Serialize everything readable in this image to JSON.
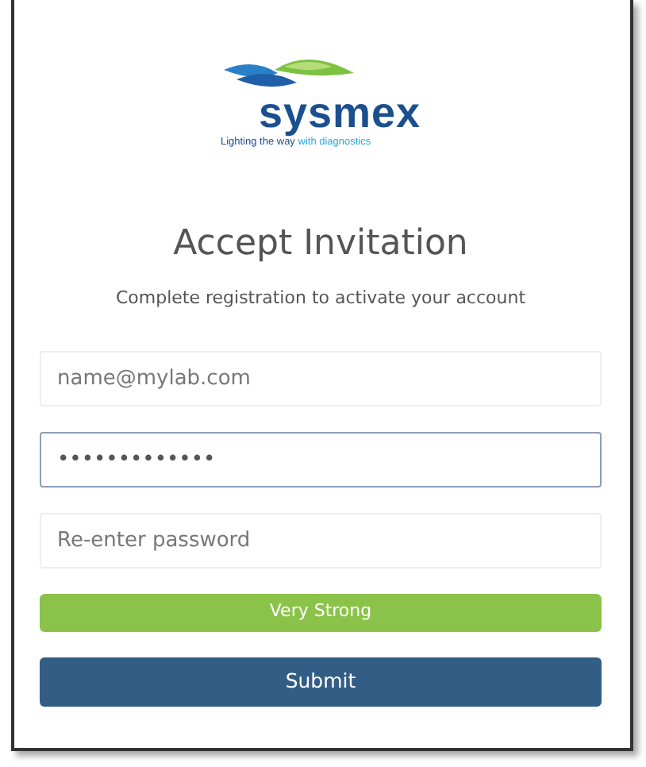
{
  "logo": {
    "wordmark": "sysmex",
    "tagline": "Lighting the way",
    "tagline_accent": "with diagnostics"
  },
  "title": "Accept Invitation",
  "subtitle": "Complete registration to activate your account",
  "fields": [
    {
      "placeholder": "name@mylab.com",
      "selected": false
    },
    {
      "value": "•••••••••••••",
      "selected": true
    },
    {
      "placeholder": "Re-enter password",
      "selected": false
    }
  ],
  "strength": {
    "label": "Very Strong",
    "level": 1
  },
  "submit": "Submit"
}
